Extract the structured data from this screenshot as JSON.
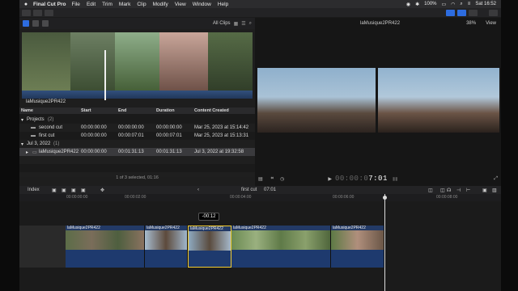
{
  "menubar": {
    "apple": "",
    "app_name": "Final Cut Pro",
    "items": [
      "File",
      "Edit",
      "Trim",
      "Mark",
      "Clip",
      "Modify",
      "View",
      "Window",
      "Help"
    ],
    "battery": "100%",
    "clock": "Sat 16:52"
  },
  "browser": {
    "filter": "All Clips",
    "filmstrip_label": "laMusique2PR422",
    "columns": [
      "Name",
      "Start",
      "End",
      "Duration",
      "Content Created"
    ],
    "rows": [
      {
        "name": "Projects",
        "count": "(2)",
        "start": "",
        "end": "",
        "duration": "",
        "created": ""
      },
      {
        "name": "second cut",
        "count": "",
        "start": "00:00:00:00",
        "end": "00:00:00:00",
        "duration": "00:00:00:00",
        "created": "Mar 25, 2023 at 15:14:42"
      },
      {
        "name": "first cut",
        "count": "",
        "start": "00:00:00:00",
        "end": "00:00:07:01",
        "duration": "00:00:07:01",
        "created": "Mar 25, 2023 at 15:13:31"
      },
      {
        "name": "Jul 3, 2022",
        "count": "(1)",
        "start": "",
        "end": "",
        "duration": "",
        "created": ""
      },
      {
        "name": "laMusique2PR422",
        "count": "",
        "start": "00:00:00:00",
        "end": "00:01:31:13",
        "duration": "00:01:31:13",
        "created": "Jul 3, 2022 at 19:32:58"
      }
    ],
    "footer": "1 of 3 selected, 01:16"
  },
  "viewer": {
    "title": "laMusique2PR422",
    "zoom": "38%",
    "view_menu": "View",
    "timecode_dim": "00:00:0",
    "timecode_bright": "7:01"
  },
  "timeline": {
    "index_label": "Index",
    "project_name": "first cut",
    "project_duration": "07:01",
    "ruler": [
      "00:00:00:00",
      "00:00:02:00",
      "00:00:04:00",
      "00:00:06:00",
      "00:00:08:00"
    ],
    "tooltip": "-00:12",
    "clips": [
      "laMusique2PR422",
      "laMusique2PR422",
      "laMusique2PR422",
      "laMusique2PR422",
      "laMusique2PR422"
    ]
  }
}
